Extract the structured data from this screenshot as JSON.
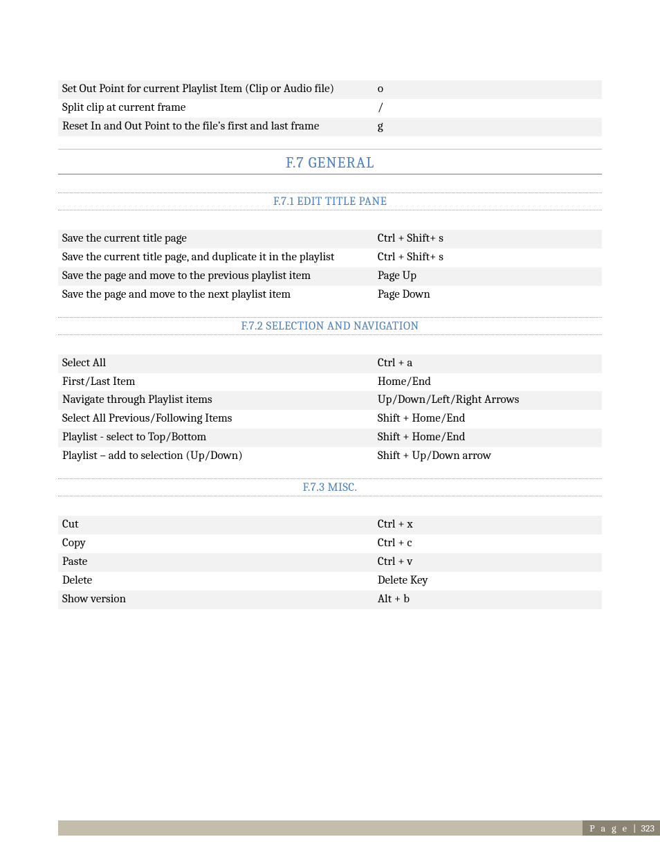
{
  "tables": {
    "top": [
      {
        "action": "Set  Out Point for current Playlist Item (Clip or Audio file)",
        "key": "o"
      },
      {
        "action": "Split clip at current frame",
        "key": "/"
      },
      {
        "action": "Reset In and Out Point to the file’s first and last frame",
        "key": "g"
      }
    ],
    "editTitlePane": [
      {
        "action": "Save the current title page",
        "key": "Ctrl + Shift+ s"
      },
      {
        "action": "Save the current title page, and duplicate it in the playlist",
        "key": "Ctrl + Shift+ s"
      },
      {
        "action": "Save the page and move to the previous playlist item",
        "key": "Page Up"
      },
      {
        "action": "Save the page and move to the next playlist item",
        "key": "Page Down"
      }
    ],
    "selectionNav": [
      {
        "action": "Select All",
        "key": "Ctrl + a"
      },
      {
        "action": "First/Last Item",
        "key": "Home/End"
      },
      {
        "action": "Navigate through Playlist items",
        "key": "Up/Down/Left/Right  Arrows"
      },
      {
        "action": "Select All Previous/Following Items",
        "key": "Shift + Home/End"
      },
      {
        "action": "Playlist - select to Top/Bottom",
        "key": "Shift + Home/End"
      },
      {
        "action": "Playlist – add to selection (Up/Down)",
        "key": "Shift + Up/Down arrow"
      }
    ],
    "misc": [
      {
        "action": "Cut",
        "key": "Ctrl + x"
      },
      {
        "action": "Copy",
        "key": "Ctrl + c"
      },
      {
        "action": "Paste",
        "key": "Ctrl + v"
      },
      {
        "action": "Delete",
        "key": "Delete Key"
      },
      {
        "action": "Show version",
        "key": "Alt + b"
      }
    ]
  },
  "headings": {
    "h1_general": "F.7  GENERAL",
    "h2_editTitlePane": "F.7.1 EDIT TITLE PANE",
    "h2_selectionNav": "F.7.2 SELECTION AND NAVIGATION",
    "h2_misc": "F.7.3 MISC."
  },
  "footer": {
    "label": "P a g e  | ",
    "number": "323"
  }
}
